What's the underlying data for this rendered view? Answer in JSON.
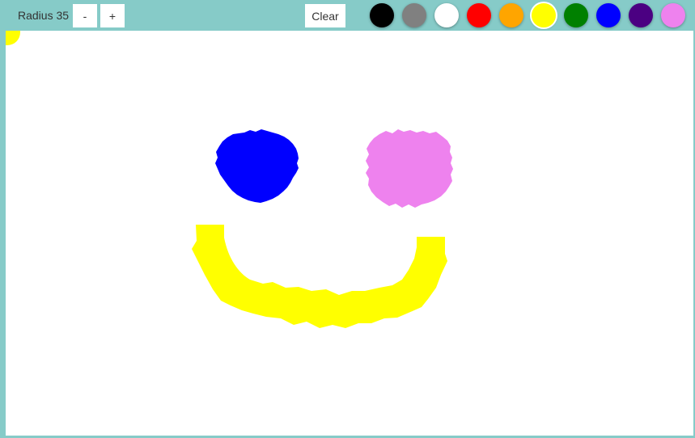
{
  "toolbar": {
    "radius_label": "Radius 35",
    "minus_label": "-",
    "plus_label": "+",
    "clear_label": "Clear"
  },
  "palette": {
    "selected": "yellow",
    "colors": [
      {
        "name": "black",
        "hex": "#000000"
      },
      {
        "name": "gray",
        "hex": "#808080"
      },
      {
        "name": "white",
        "hex": "#ffffff"
      },
      {
        "name": "red",
        "hex": "#ff0000"
      },
      {
        "name": "orange",
        "hex": "#ffa500"
      },
      {
        "name": "yellow",
        "hex": "#ffff00"
      },
      {
        "name": "green",
        "hex": "#008000"
      },
      {
        "name": "blue",
        "hex": "#0000ff"
      },
      {
        "name": "indigo",
        "hex": "#4b0082"
      },
      {
        "name": "violet",
        "hex": "#ee82ee"
      }
    ]
  },
  "canvas": {
    "background": "#ffffff",
    "strokes": [
      {
        "name": "corner-dot",
        "color": "#ffff00"
      },
      {
        "name": "left-eye",
        "color": "#0000ff"
      },
      {
        "name": "right-eye",
        "color": "#ee82ee"
      },
      {
        "name": "smile",
        "color": "#ffff00"
      }
    ]
  }
}
